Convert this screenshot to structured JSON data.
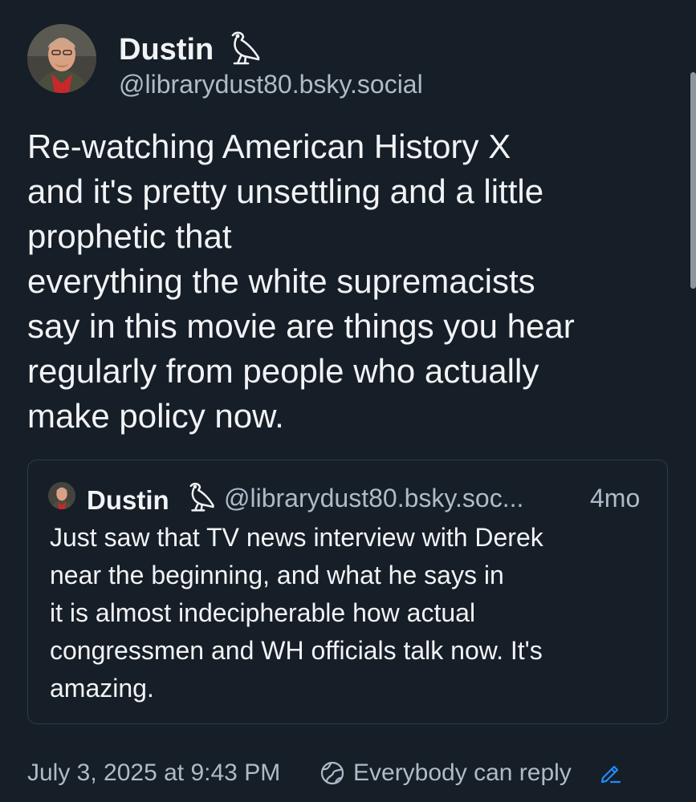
{
  "author": {
    "display_name": "Dustin",
    "handle": "@librarydust80.bsky.social",
    "name_icon": "hieroglyph-bird-icon",
    "avatar_icon": "user-avatar"
  },
  "post": {
    "lines": [
      "Re-watching American History X",
      "and it's pretty unsettling and a little",
      "prophetic that",
      "everything the white supremacists",
      "say in this movie are things you hear",
      "regularly from people who actually",
      "make policy now."
    ]
  },
  "quote": {
    "display_name": "Dustin",
    "handle": "@librarydust80.bsky.soc...",
    "time": "4mo",
    "lines": [
      "Just saw that TV news interview with Derek",
      "near the beginning, and what he says in",
      "it is almost indecipherable how actual",
      "congressmen and WH officials talk now. It's",
      "amazing."
    ]
  },
  "footer": {
    "timestamp": "July 3, 2025 at 9:43 PM",
    "reply_setting": "Everybody can reply",
    "reply_icon": "globe-icon",
    "edit_icon": "pencil-icon"
  },
  "colors": {
    "background": "#161e27",
    "text": "#f1f3f5",
    "muted": "#aebbc9",
    "link": "#208bfe",
    "border": "#2e3b49"
  }
}
